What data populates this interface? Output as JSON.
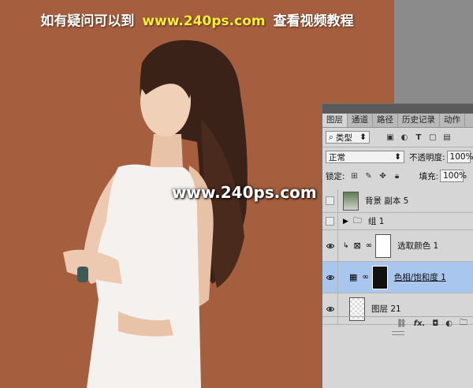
{
  "banner": {
    "left_text": "如有疑问可以到",
    "url": "www.240ps.com",
    "right_text": "查看视频教程"
  },
  "watermark": "www.240ps.com",
  "colors": {
    "canvas_bg": "#a65f3e",
    "selected_layer": "#a9c7ee",
    "banner_url": "#ffee33"
  },
  "layers_panel": {
    "tabs": [
      {
        "label": "图层",
        "active": true
      },
      {
        "label": "通道",
        "active": false
      },
      {
        "label": "路径",
        "active": false
      },
      {
        "label": "历史记录",
        "active": false
      },
      {
        "label": "动作",
        "active": false
      }
    ],
    "filter": {
      "kind_label": "类型",
      "icons": [
        "image-filter-icon",
        "adjustment-filter-icon",
        "type-filter-icon",
        "shape-filter-icon",
        "smart-object-filter-icon"
      ]
    },
    "blend": {
      "mode": "正常",
      "opacity_label": "不透明度:",
      "opacity_value": "100%"
    },
    "lock": {
      "label": "锁定:",
      "fill_label": "填充:",
      "fill_value": "100%"
    },
    "layers": [
      {
        "name": "背景 副本 5",
        "visible": false,
        "type": "photo"
      },
      {
        "name": "组 1",
        "visible": false,
        "type": "group"
      },
      {
        "name": "选取颜色 1",
        "visible": true,
        "type": "selective-color",
        "clipped": true
      },
      {
        "name": "色相/饱和度 1",
        "visible": true,
        "type": "hue-saturation",
        "selected": true
      },
      {
        "name": "图层 21",
        "visible": true,
        "type": "layer"
      }
    ],
    "footer_icons": [
      "link-layers-icon",
      "fx-icon",
      "add-mask-icon",
      "adjustment-layer-icon",
      "new-group-icon"
    ],
    "footer_fx": "fx."
  }
}
